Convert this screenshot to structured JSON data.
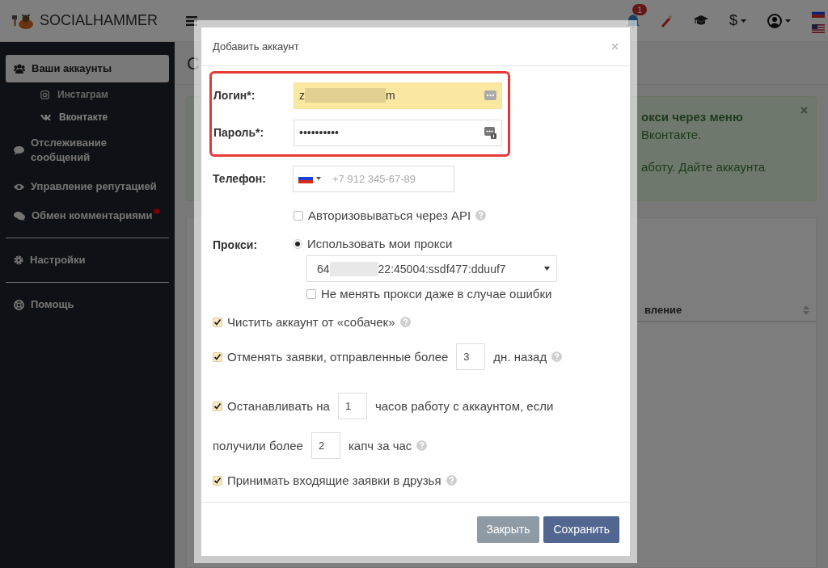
{
  "top_bar": {
    "logo": "SOCIALHAMMER",
    "notification_count": "1",
    "currency": "$",
    "languages": [
      {
        "kind": "ru"
      },
      {
        "kind": "us"
      }
    ]
  },
  "sidebar": {
    "items": [
      {
        "kind": "item",
        "label": "Ваши аккаунты",
        "selected": true,
        "alert": false,
        "children": [
          {
            "label": "Инстаграм",
            "selected": false
          },
          {
            "label": "Вконтакте",
            "selected": true
          }
        ]
      },
      {
        "kind": "item",
        "label": "Отслеживание сообщений",
        "selected": false,
        "alert": false
      },
      {
        "kind": "item",
        "label": "Управление репутацией",
        "selected": false,
        "alert": false
      },
      {
        "kind": "item",
        "label": "Обмен комментариями",
        "selected": false,
        "alert": true
      },
      {
        "kind": "divider"
      },
      {
        "kind": "item",
        "label": "Настройки",
        "selected": false,
        "alert": false
      },
      {
        "kind": "divider"
      },
      {
        "kind": "item",
        "label": "Помощь",
        "selected": false,
        "alert": false
      }
    ]
  },
  "page": {
    "title": "С",
    "notice": {
      "lines": [
        {
          "text": "окси через меню",
          "bold": true
        },
        {
          "text": "Вконтакте.",
          "bold": false
        },
        {
          "text": "аботу. Дайте аккаунта",
          "bold": false
        }
      ]
    },
    "table": {
      "columns": [
        "вление"
      ]
    }
  },
  "dialog": {
    "title": "Добавить аккаунт",
    "fields": [
      {
        "kind": "text",
        "label": "Логин*:",
        "value_start": "z",
        "value_end": "m",
        "autofilled": true,
        "highlighted": true
      },
      {
        "kind": "password",
        "label": "Пароль*:",
        "value": "••••••••••",
        "autofilled": false,
        "highlighted": true
      },
      {
        "kind": "phone",
        "label": "Телефон:",
        "placeholder": "+7 912 345-67-89",
        "autofilled": false,
        "highlighted": false
      }
    ],
    "api_option": {
      "label": "Авторизовываться через API",
      "checked": false,
      "help": true
    },
    "proxy": {
      "label": "Прокси:",
      "mode": {
        "label": "Использовать мои прокси",
        "selected": true
      },
      "value_start": "64",
      "value_end": "22:45004:ssdf477:dduuf7",
      "keep": {
        "label": "Не менять прокси даже в случае ошибки",
        "checked": false
      }
    },
    "settings": [
      {
        "checked": true,
        "help": true,
        "parts": [
          {
            "kind": "text",
            "text": "Чистить аккаунт от «собачек»"
          }
        ]
      },
      {
        "checked": true,
        "help": true,
        "parts": [
          {
            "kind": "text",
            "text": "Отменять заявки, отправленные более"
          },
          {
            "kind": "number",
            "value": "3"
          },
          {
            "kind": "text",
            "text": "дн. назад"
          }
        ]
      },
      {
        "checked": true,
        "help": true,
        "parts": [
          {
            "kind": "text",
            "text": "Останавливать на"
          },
          {
            "kind": "number",
            "value": "1"
          },
          {
            "kind": "text",
            "text": "часов работу с аккаунтом, если"
          },
          {
            "kind": "break"
          },
          {
            "kind": "text",
            "text": "получили более"
          },
          {
            "kind": "number",
            "value": "2"
          },
          {
            "kind": "text",
            "text": "капч за час"
          }
        ]
      },
      {
        "checked": true,
        "help": true,
        "parts": [
          {
            "kind": "text",
            "text": "Принимать входящие заявки в друзья"
          }
        ]
      }
    ],
    "buttons": [
      {
        "kind": "secondary",
        "label": "Закрыть"
      },
      {
        "kind": "primary",
        "label": "Сохранить"
      }
    ]
  }
}
